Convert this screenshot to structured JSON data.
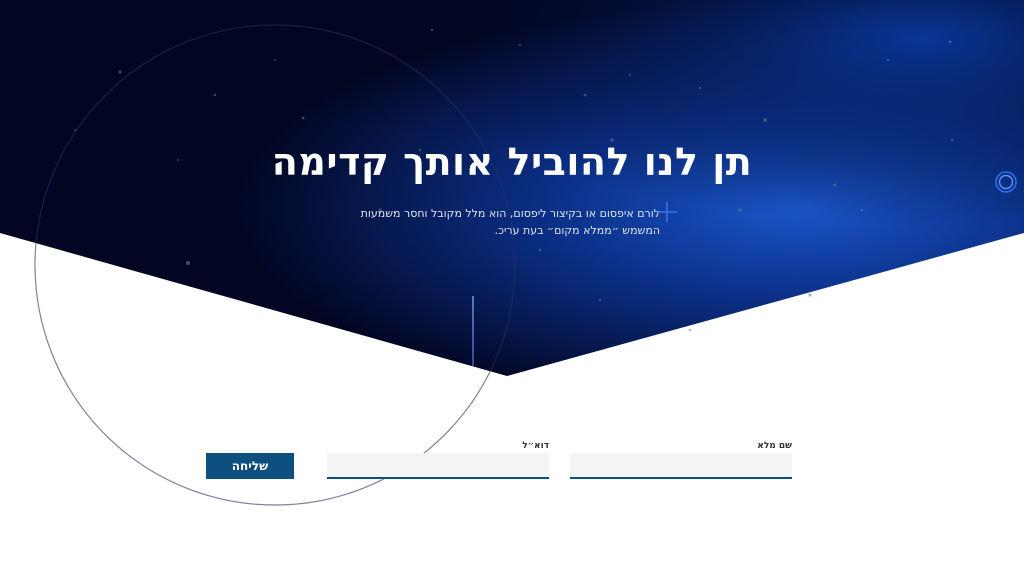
{
  "hero": {
    "title": "תן לנו להוביל אותך קדימה",
    "subtitle": "לורם איפסום או בקיצור ליפסום, הוא מלל מקובל וחסר משמעות המשמש ״ממלא מקום״ בעת עריכ."
  },
  "form": {
    "full_name_label": "שם מלא",
    "full_name_value": "",
    "email_label": "דוא״ל",
    "email_value": "",
    "submit_label": "שליחה"
  },
  "colors": {
    "hero_dark": "#02061f",
    "hero_blue": "#0a3a9a",
    "accent": "#0d4f7f"
  },
  "icons": {
    "ring": "ring-icon",
    "plus": "plus-icon"
  }
}
